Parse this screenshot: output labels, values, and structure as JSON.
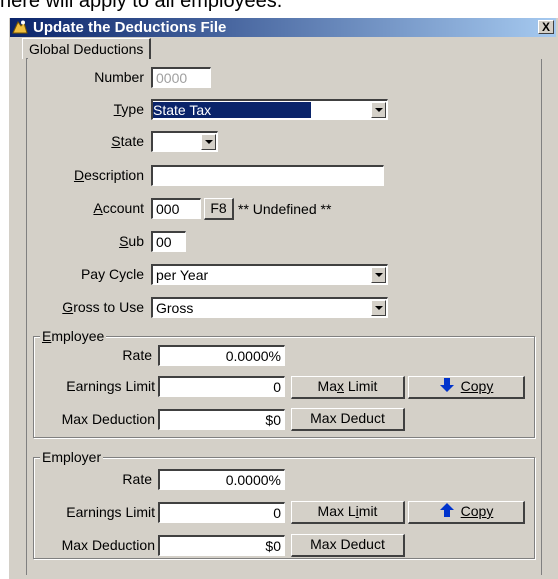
{
  "caption_fragment": "here will apply to all employees.",
  "window": {
    "title": "Update the Deductions File",
    "close_glyph": "X",
    "icon": "app-icon"
  },
  "tab": {
    "label": "Global Deductions"
  },
  "fields": {
    "number": {
      "label": "Number",
      "value": "0000"
    },
    "type": {
      "label_u": "T",
      "label_rest": "ype",
      "value": "State Tax"
    },
    "state": {
      "label_u": "S",
      "label_rest": "tate",
      "value": ""
    },
    "description": {
      "label_u": "D",
      "label_rest": "escription",
      "value": ""
    },
    "account": {
      "label_u": "A",
      "label_rest": "ccount",
      "value": "000",
      "lookup_button": "F8",
      "status": "** Undefined **"
    },
    "sub": {
      "label_u": "S",
      "label_rest": "ub",
      "value": "00"
    },
    "pay_cycle": {
      "label": "Pay Cycle",
      "value": "per Year"
    },
    "gross_to_use": {
      "label_u": "G",
      "label_rest": "ross to Use",
      "value": "Gross"
    }
  },
  "employee": {
    "title_u": "E",
    "title_rest": "mployee",
    "rate_label": "Rate",
    "rate_value": "0.0000%",
    "earnings_label": "Earnings Limit",
    "earnings_value": "0",
    "max_limit_pre": "Ma",
    "max_limit_u": "x",
    "max_limit_post": " Limit",
    "copy_label": "Copy",
    "copy_icon": "arrow-down-icon",
    "max_deduction_label": "Max Deduction",
    "max_deduction_value": "$0",
    "max_deduct_button": "Max Deduct"
  },
  "employer": {
    "title": "Employer",
    "rate_label": "Rate",
    "rate_value": "0.0000%",
    "earnings_label": "Earnings Limit",
    "earnings_value": "0",
    "max_limit_pre": "Max L",
    "max_limit_u": "i",
    "max_limit_post": "mit",
    "copy_label": "Copy",
    "copy_icon": "arrow-up-icon",
    "max_deduction_label": "Max Deduction",
    "max_deduction_value": "$0",
    "max_deduct_button": "Max Deduct"
  },
  "colors": {
    "titlebar_start": "#0a246a",
    "titlebar_end": "#a6caf0",
    "face": "#d4d0c8",
    "arrow_blue": "#0033cc",
    "selection": "#0a246a"
  }
}
